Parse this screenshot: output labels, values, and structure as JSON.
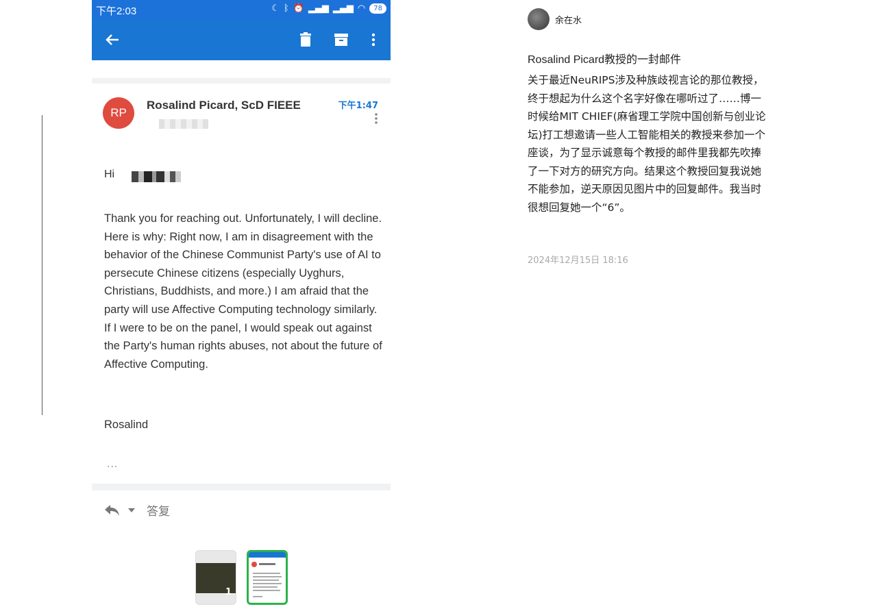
{
  "phone": {
    "status_time": "下午2:03",
    "battery": "78",
    "sender_initials": "RP",
    "sender_name": "Rosalind Picard, ScD FIEEE",
    "mail_time": "下午1:47",
    "greeting": "Hi",
    "body": "Thank you for reaching out. Unfortunately, I will decline. Here is why: Right now, I am in disagreement with the behavior of the Chinese Communist Party's use of AI to persecute Chinese citizens (especially Uyghurs, Christians, Buddhists, and more.) I am afraid that the party will use Affective Computing technology similarly. If I were to be on the panel, I would speak out against the Party's human rights abuses, not about the future of Affective Computing.",
    "signature": "Rosalind",
    "more": "...",
    "reply_label": "答复"
  },
  "thumbnails": [
    {
      "index": "1",
      "selected": false
    },
    {
      "index": "2",
      "selected": true
    }
  ],
  "post": {
    "author": "余在水",
    "title": "Rosalind Picard教授的一封邮件",
    "body": "关于最近NeuRIPS涉及种族歧视言论的那位教授，终于想起为什么这个名字好像在哪听过了……博一时候给MIT CHIEF(麻省理工学院中国创新与创业论坛)打工想邀请一些人工智能相关的教授来参加一个座谈，为了显示诚意每个教授的邮件里我都先吹捧了一下对方的研究方向。结果这个教授回复我说她不能参加，逆天原因见图片中的回复邮件。我当时很想回复她一个“6”。",
    "timestamp": "2024年12月15日 18:16"
  },
  "colors": {
    "toolbar": "#1976d2",
    "avatar": "#e04b3f",
    "thumb_selected": "#2ab24a"
  }
}
